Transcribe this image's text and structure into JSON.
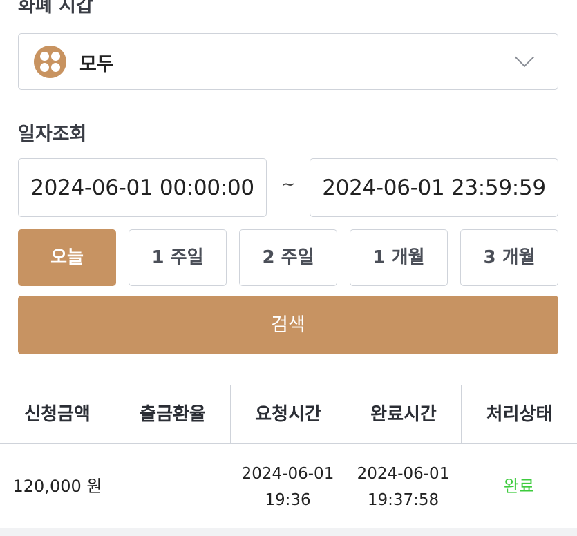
{
  "filters": {
    "currency_label": "화폐 시갑",
    "currency_selected": "모두",
    "date_label": "일자조회",
    "date_start": "2024-06-01 00:00:00",
    "date_separator": "~",
    "date_end": "2024-06-01 23:59:59",
    "periods": [
      "오늘",
      "1 주일",
      "2 주일",
      "1 개월",
      "3 개월"
    ],
    "active_period": "오늘",
    "search_label": "검색"
  },
  "table": {
    "headers": [
      "신청금액",
      "출금환율",
      "요청시간",
      "완료시간",
      "처리상태"
    ],
    "rows": [
      {
        "amount": "120,000 원",
        "rate": "",
        "request_date": "2024-06-01",
        "request_time": "19:36",
        "complete_date": "2024-06-01",
        "complete_time": "19:37:58",
        "status": "완료"
      }
    ]
  },
  "colors": {
    "accent": "#c79362",
    "status_complete": "#3ecb3e",
    "border": "#cfd3da"
  },
  "icons": {
    "currency": "coin-grid-icon",
    "dropdown": "chevron-down-icon"
  }
}
